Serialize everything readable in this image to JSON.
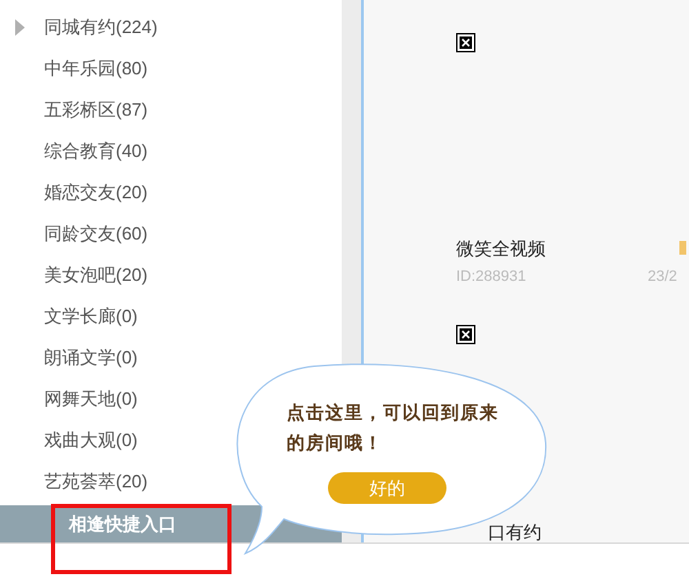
{
  "sidebar": {
    "items": [
      {
        "label": "同城有约(224)",
        "expandable": true,
        "selected": false
      },
      {
        "label": "中年乐园(80)",
        "expandable": false,
        "selected": false
      },
      {
        "label": "五彩桥区(87)",
        "expandable": false,
        "selected": false
      },
      {
        "label": "综合教育(40)",
        "expandable": false,
        "selected": false
      },
      {
        "label": "婚恋交友(20)",
        "expandable": false,
        "selected": false
      },
      {
        "label": "同龄交友(60)",
        "expandable": false,
        "selected": false
      },
      {
        "label": "美女泡吧(20)",
        "expandable": false,
        "selected": false
      },
      {
        "label": "文学长廊(0)",
        "expandable": false,
        "selected": false
      },
      {
        "label": "朗诵文学(0)",
        "expandable": false,
        "selected": false
      },
      {
        "label": "网舞天地(0)",
        "expandable": false,
        "selected": false
      },
      {
        "label": "戏曲大观(0)",
        "expandable": false,
        "selected": false
      },
      {
        "label": "艺苑荟萃(20)",
        "expandable": false,
        "selected": false
      },
      {
        "label": "相逢快捷入口",
        "expandable": false,
        "selected": true
      }
    ]
  },
  "rooms": [
    {
      "title": "微笑全视频",
      "id": "ID:288931",
      "count": "23/2"
    },
    {
      "title": "口有约"
    }
  ],
  "tip": {
    "message": "点击这里，可以回到原来的房间哦！",
    "button": "好的"
  }
}
